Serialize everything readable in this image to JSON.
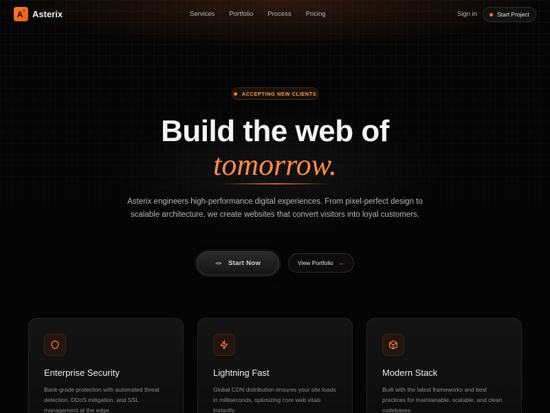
{
  "brand": {
    "logo_mark": "A",
    "logo_sup": "*",
    "name": "Asterix",
    "accent_color": "#ff7a32"
  },
  "nav": {
    "links": [
      "Services",
      "Portfolio",
      "Process",
      "Pricing"
    ],
    "sign_in": "Sign in",
    "cta": "Start Project"
  },
  "badge": {
    "text": "ACCEPTING NEW CLIENTS"
  },
  "hero": {
    "title": "Build the web of",
    "accent": "tomorrow.",
    "subtitle": "Asterix engineers high-performance digital experiences. From pixel-perfect design to scalable architecture, we create websites that convert visitors into loyal customers.",
    "primary_cta": "Start Now",
    "secondary_cta": "View Portfolio"
  },
  "features": [
    {
      "icon": "shield-icon",
      "title": "Enterprise Security",
      "description": "Bank-grade protection with automated threat detection, DDoS mitigation, and SSL management at the edge."
    },
    {
      "icon": "lightning-icon",
      "title": "Lightning Fast",
      "description": "Global CDN distribution ensures your site loads in milliseconds, optimizing core web vitals instantly."
    },
    {
      "icon": "cube-icon",
      "title": "Modern Stack",
      "description": "Built with the latest frameworks and best practices for maintainable, scalable, and clean codebases."
    }
  ]
}
